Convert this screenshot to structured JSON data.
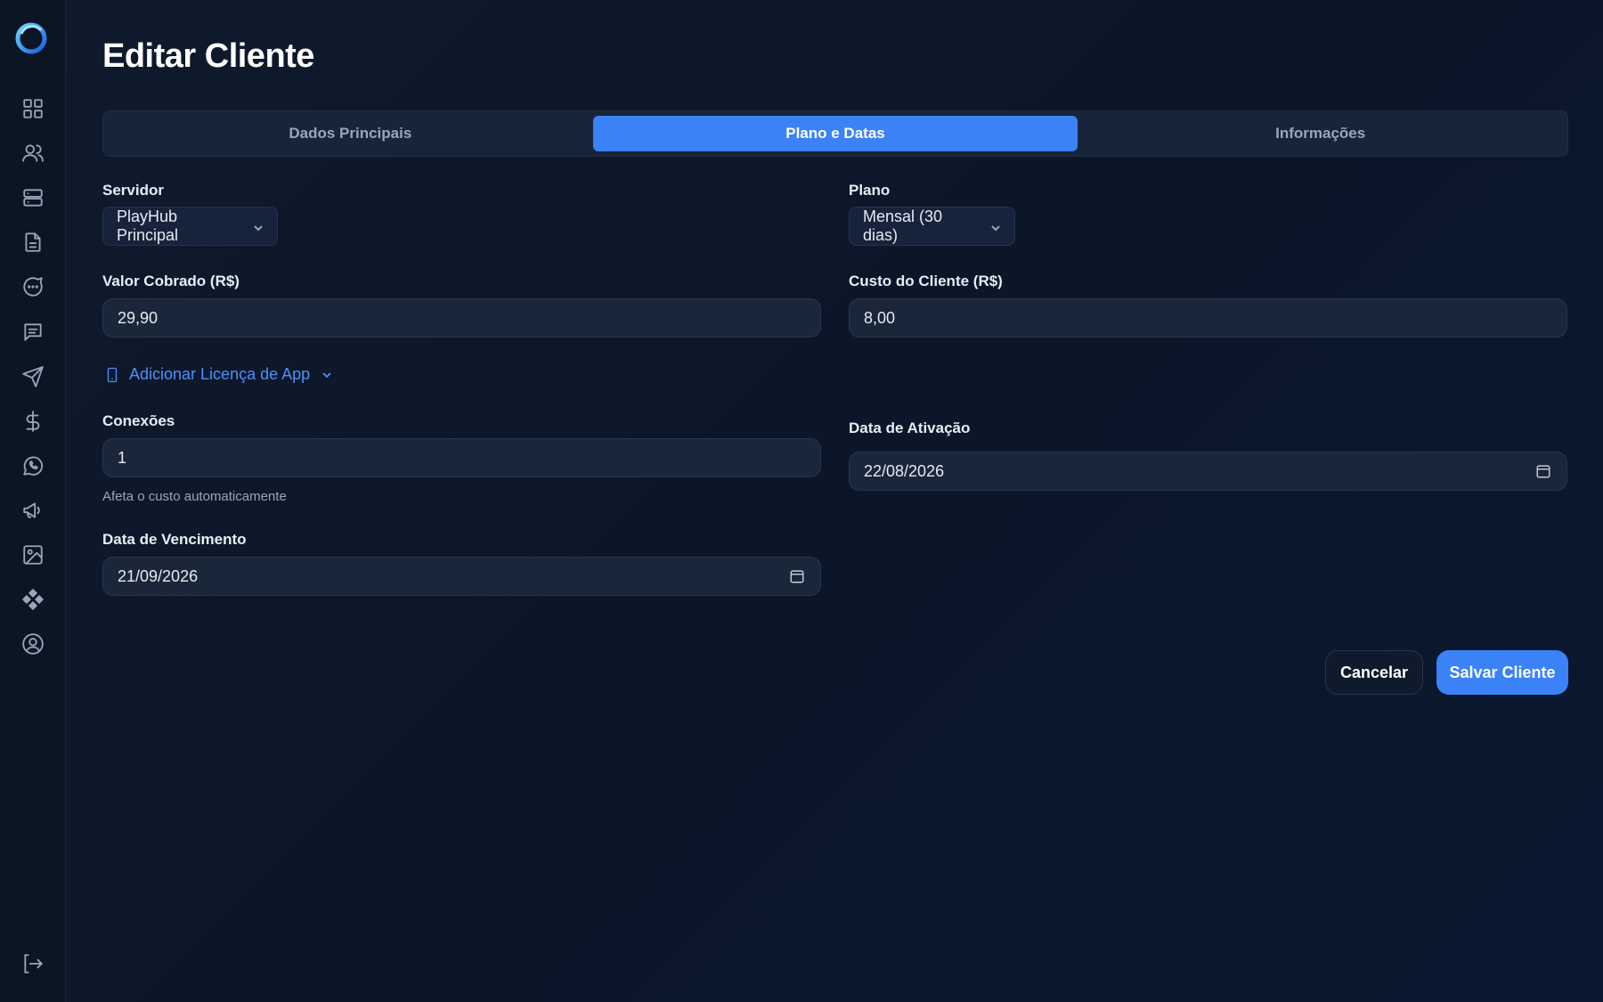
{
  "page": {
    "title": "Editar Cliente"
  },
  "sidebar": {
    "icons": [
      "dashboard-icon",
      "users-icon",
      "server-icon",
      "document-icon",
      "chat-bubble-icon",
      "message-square-icon",
      "send-icon",
      "dollar-icon",
      "whatsapp-icon",
      "megaphone-icon",
      "image-icon",
      "components-icon",
      "user-circle-icon"
    ],
    "logout": "logout-icon"
  },
  "tabs": [
    {
      "label": "Dados Principais",
      "active": false
    },
    {
      "label": "Plano e Datas",
      "active": true
    },
    {
      "label": "Informações",
      "active": false
    }
  ],
  "form": {
    "servidor": {
      "label": "Servidor",
      "value": "PlayHub Principal"
    },
    "plano": {
      "label": "Plano",
      "value": "Mensal (30 dias)"
    },
    "valor": {
      "label": "Valor Cobrado (R$)",
      "value": "29,90"
    },
    "custo": {
      "label": "Custo do Cliente (R$)",
      "value": "8,00"
    },
    "app_license": {
      "label": "Adicionar Licença de App"
    },
    "conexoes": {
      "label": "Conexões",
      "value": "1",
      "help": "Afeta o custo automaticamente"
    },
    "ativacao": {
      "label": "Data de Ativação",
      "value": "22/08/2026"
    },
    "vencimento": {
      "label": "Data de Vencimento",
      "value": "21/09/2026"
    }
  },
  "actions": {
    "cancel": "Cancelar",
    "save": "Salvar Cliente"
  },
  "colors": {
    "accent": "#3b82f6",
    "background": "#0c1628",
    "link": "#4f8ff7"
  }
}
